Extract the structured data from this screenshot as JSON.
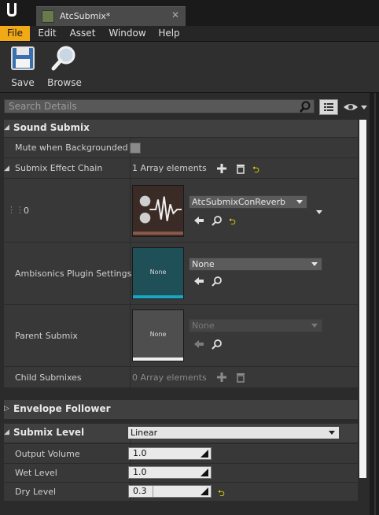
{
  "window": {
    "tab_title": "AtcSubmix*",
    "tab_close": "✕"
  },
  "menu": {
    "items": [
      "File",
      "Edit",
      "Asset",
      "Window",
      "Help"
    ],
    "active": "File"
  },
  "toolbar": {
    "save_label": "Save",
    "browse_label": "Browse"
  },
  "search": {
    "placeholder": "Search Details"
  },
  "sections": {
    "sound_submix": "Sound Submix",
    "envelope_follower": "Envelope Follower",
    "submix_level": "Submix Level"
  },
  "props": {
    "mute_label": "Mute when Backgrounded",
    "effect_chain_label": "Submix Effect Chain",
    "effect_chain_count": "1 Array elements",
    "element_index": "0",
    "effect_asset": "AtcSubmixConReverb",
    "ambisonics_label": "Ambisonics Plugin Settings",
    "ambisonics_value": "None",
    "ambisonics_thumb": "None",
    "parent_label": "Parent Submix",
    "parent_value": "None",
    "parent_thumb": "None",
    "child_label": "Child Submixes",
    "child_count": "0 Array elements",
    "submix_level_value": "Linear",
    "output_volume_label": "Output Volume",
    "output_volume": "1.0",
    "wet_level_label": "Wet Level",
    "wet_level": "1.0",
    "dry_level_label": "Dry Level",
    "dry_level": "0.3"
  },
  "glyphs": {
    "reset": "⮌",
    "expanded": "◢",
    "collapsed": "▷"
  },
  "colors": {
    "accent": "#f1a916",
    "ambisonics_thumb": "#1f4f57",
    "ambisonics_bar": "#1aa6c0"
  },
  "icons": [
    "ue-logo-icon",
    "save-icon",
    "browse-icon",
    "search-icon",
    "grid-view-icon",
    "eye-icon",
    "add-icon",
    "trash-icon",
    "reset-icon",
    "use-selected-icon",
    "browse-asset-icon"
  ]
}
